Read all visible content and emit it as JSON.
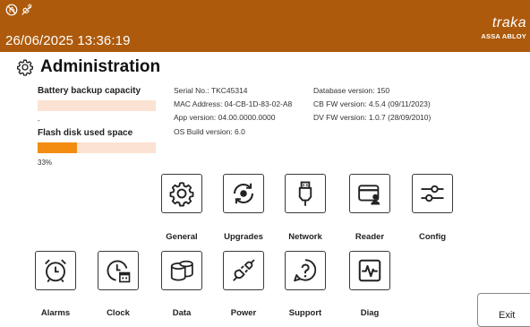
{
  "header": {
    "datetime": "26/06/2025 13:36:19",
    "brand_name": "traka",
    "brand_sub": "ASSA ABLOY",
    "status_icons": [
      "no-touch-icon",
      "unplugged-icon"
    ],
    "background": "#ad5a0c"
  },
  "page": {
    "title": "Administration",
    "title_icon": "gear-icon"
  },
  "meters": {
    "battery": {
      "label": "Battery backup capacity",
      "value_text": "-",
      "fraction": 0
    },
    "flash": {
      "label": "Flash disk used space",
      "value_text": "33%",
      "fraction": 0.33
    },
    "fill_color": "#f28d12",
    "track_color": "#fbe2d2"
  },
  "info": {
    "serial": "Serial No.: TKC45314",
    "mac": "MAC Address: 04-CB-1D-83-02-A8",
    "app_version": "App version: 04.00.0000.0000",
    "os_build": "OS Build version: 6.0",
    "db_version": "Database version: 150",
    "cb_fw": "CB FW version: 4.5.4 (09/11/2023)",
    "dv_fw": "DV FW version: 1.0.7 (28/09/2010)"
  },
  "tiles": {
    "general": {
      "label": "General",
      "icon": "gear-icon"
    },
    "upgrades": {
      "label": "Upgrades",
      "icon": "upgrade-icon"
    },
    "network": {
      "label": "Network",
      "icon": "ethernet-plug-icon"
    },
    "reader": {
      "label": "Reader",
      "icon": "card-reader-icon"
    },
    "config": {
      "label": "Config",
      "icon": "sliders-icon"
    },
    "alarms": {
      "label": "Alarms",
      "icon": "alarm-clock-icon"
    },
    "clock": {
      "label": "Clock",
      "icon": "clock-calendar-icon"
    },
    "data": {
      "label": "Data",
      "icon": "database-icon"
    },
    "power": {
      "label": "Power",
      "icon": "power-plug-icon"
    },
    "support": {
      "label": "Support",
      "icon": "help-icon"
    },
    "diag": {
      "label": "Diag",
      "icon": "pulse-icon"
    }
  },
  "exit_label": "Exit"
}
